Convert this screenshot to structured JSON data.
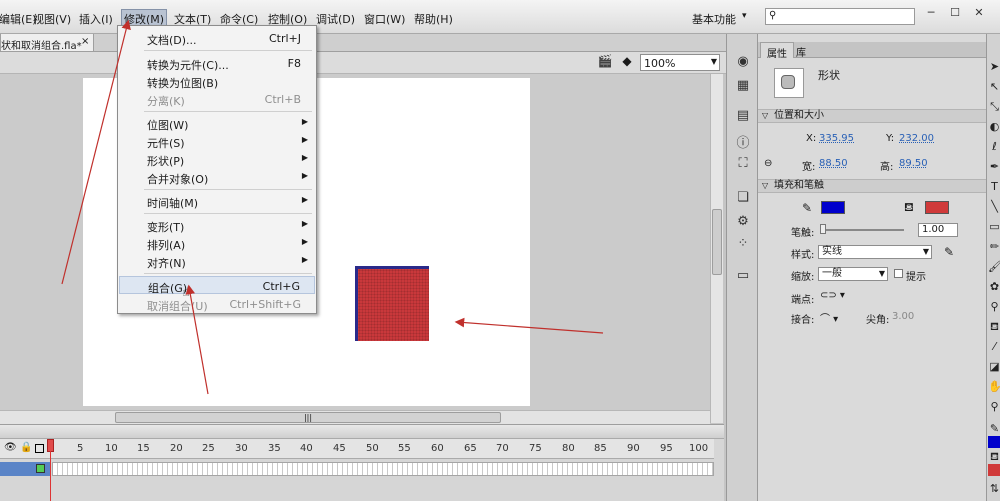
{
  "menubar": {
    "items": [
      "编辑(E)",
      "视图(V)",
      "插入(I)",
      "修改(M)",
      "文本(T)",
      "命令(C)",
      "控制(O)",
      "调试(D)",
      "窗口(W)",
      "帮助(H)"
    ],
    "workspace": "基本功能",
    "search_placeholder": ""
  },
  "document": {
    "tab_title": "状和取消组合.fla*"
  },
  "stage_toolbar": {
    "zoom": "100%"
  },
  "modify_menu": {
    "items": [
      {
        "label": "文档(D)...",
        "shortcut": "Ctrl+J",
        "submenu": false,
        "disabled": false
      },
      {
        "label": "转换为元件(C)...",
        "shortcut": "F8",
        "submenu": false,
        "disabled": false
      },
      {
        "label": "转换为位图(B)",
        "shortcut": "",
        "submenu": false,
        "disabled": false
      },
      {
        "label": "分离(K)",
        "shortcut": "Ctrl+B",
        "submenu": false,
        "disabled": true
      },
      {
        "label": "位图(W)",
        "shortcut": "",
        "submenu": true,
        "disabled": false
      },
      {
        "label": "元件(S)",
        "shortcut": "",
        "submenu": true,
        "disabled": false
      },
      {
        "label": "形状(P)",
        "shortcut": "",
        "submenu": true,
        "disabled": false
      },
      {
        "label": "合并对象(O)",
        "shortcut": "",
        "submenu": true,
        "disabled": false
      },
      {
        "label": "时间轴(M)",
        "shortcut": "",
        "submenu": true,
        "disabled": false
      },
      {
        "label": "变形(T)",
        "shortcut": "",
        "submenu": true,
        "disabled": false
      },
      {
        "label": "排列(A)",
        "shortcut": "",
        "submenu": true,
        "disabled": false
      },
      {
        "label": "对齐(N)",
        "shortcut": "",
        "submenu": true,
        "disabled": false
      },
      {
        "label": "组合(G)",
        "shortcut": "Ctrl+G",
        "submenu": false,
        "disabled": false,
        "highlighted": true
      },
      {
        "label": "取消组合(U)",
        "shortcut": "Ctrl+Shift+G",
        "submenu": false,
        "disabled": true
      }
    ]
  },
  "timeline": {
    "frame_numbers": [
      "1",
      "5",
      "10",
      "15",
      "20",
      "25",
      "30",
      "35",
      "40",
      "45",
      "50",
      "55",
      "60",
      "65",
      "70",
      "75",
      "80",
      "85",
      "90",
      "95",
      "100"
    ]
  },
  "properties": {
    "tabs": [
      "属性",
      "库"
    ],
    "object_type": "形状",
    "position_size_title": "位置和大小",
    "x_label": "X:",
    "x_value": "335.95",
    "y_label": "Y:",
    "y_value": "232.00",
    "width_label": "宽:",
    "width_value": "88.50",
    "height_label": "高:",
    "height_value": "89.50",
    "fill_stroke_title": "填充和笔触",
    "stroke_color": "#0000cc",
    "fill_color": "#d03a3a",
    "stroke_width_label": "笔触:",
    "stroke_width_value": "1.00",
    "style_label": "样式:",
    "style_value": "实线",
    "scale_label": "缩放:",
    "scale_value": "一般",
    "hint_label": "提示",
    "cap_label": "端点:",
    "join_label": "接合:",
    "miter_label": "尖角:",
    "miter_value": "3.00"
  },
  "icons": [
    "search-icon",
    "close-icon",
    "minimize-icon",
    "maximize-icon",
    "edit-scene-icon",
    "edit-symbol-icon",
    "chevron-down-icon",
    "eye-icon",
    "lock-icon",
    "outline-icon",
    "pen-icon",
    "bucket-icon",
    "selection-tool-icon",
    "cursor-icon"
  ]
}
